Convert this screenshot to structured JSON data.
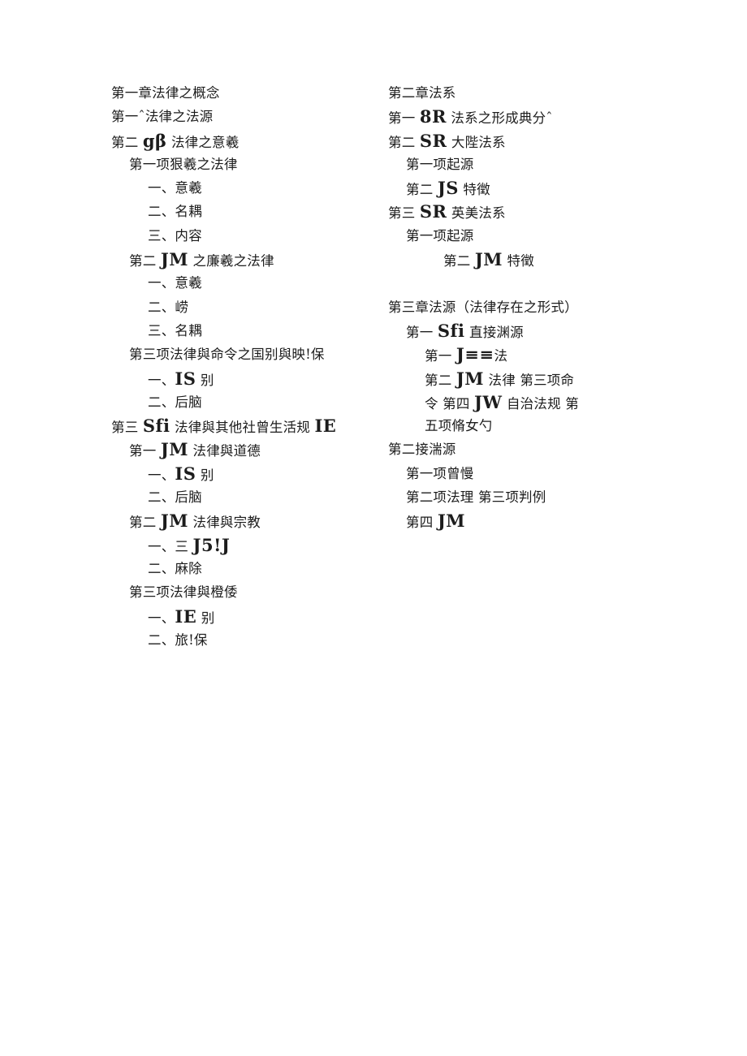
{
  "document": {
    "type": "scanned-table-of-contents",
    "page_background": "#ffffff",
    "text_color": "#1c1c1c",
    "columns": 2
  },
  "left_column": {
    "lines": [
      {
        "indent": 0,
        "text": "第一章法律之概念"
      },
      {
        "indent": 0,
        "text": "第一ˆ法律之法源"
      },
      {
        "indent": 0,
        "pre": "第二 ",
        "emph": "gβ",
        "post": " 法律之意羲"
      },
      {
        "indent": 1,
        "text": "第一项狠羲之法律"
      },
      {
        "indent": 2,
        "text": "一、意羲"
      },
      {
        "indent": 2,
        "text": "二、名耦"
      },
      {
        "indent": 2,
        "text": "三、内容"
      },
      {
        "indent": 1,
        "pre": "第二 ",
        "emph": "JM",
        "post": " 之廉羲之法律"
      },
      {
        "indent": 2,
        "text": "一、意羲"
      },
      {
        "indent": 2,
        "text": "二、崂"
      },
      {
        "indent": 2,
        "text": "三、名耦"
      },
      {
        "indent": 1,
        "text": "第三项法律與命令之国别與映!保"
      },
      {
        "indent": 2,
        "pre": "一、",
        "emph": "IS",
        "post": " 别"
      },
      {
        "indent": 2,
        "text": "二、后脑"
      },
      {
        "indent": 0,
        "pre": "第三 ",
        "emph": "Sfi",
        "post": " 法律與其他社曾生活规 ",
        "emph2": "IE"
      },
      {
        "indent": 1,
        "pre": "第一 ",
        "emph": "JM",
        "post": " 法律與道德"
      },
      {
        "indent": 2,
        "pre": "一、",
        "emph": "IS",
        "post": " 别"
      },
      {
        "indent": 2,
        "text": "二、后脑"
      },
      {
        "indent": 1,
        "pre": "第二 ",
        "emph": "JM",
        "post": " 法律與宗教"
      },
      {
        "indent": 2,
        "pre": "一、三 ",
        "emph": "J5!J",
        "post": ""
      },
      {
        "indent": 2,
        "text": "二、麻除"
      },
      {
        "indent": 1,
        "text": "第三项法律與橙倭"
      },
      {
        "indent": 2,
        "pre": "一、",
        "emph": "IE",
        "post": " 别"
      },
      {
        "indent": 2,
        "text": "二、旅!保"
      }
    ]
  },
  "right_column": {
    "lines": [
      {
        "indent": 0,
        "text": "第二章法系"
      },
      {
        "indent": 0,
        "pre": "第一 ",
        "emph": "8R",
        "post": " 法系之形成典分ˆ"
      },
      {
        "indent": 0,
        "pre": "第二 ",
        "emph": "SR",
        "post": " 大陛法系"
      },
      {
        "indent": 1,
        "text": "第一项起源"
      },
      {
        "indent": 1,
        "pre": "第二 ",
        "emph": "JS",
        "post": " 特徵"
      },
      {
        "indent": 0,
        "pre": "第三 ",
        "emph": "SR",
        "post": " 英美法系"
      },
      {
        "indent": 1,
        "text": "第一项起源"
      },
      {
        "indent": 3,
        "pre": "第二 ",
        "emph": "JM",
        "post": " 特徵"
      },
      {
        "indent": 0,
        "text": ""
      },
      {
        "indent": 0,
        "text": "第三章法源（法律存在之形式）"
      },
      {
        "indent": 1,
        "pre": "第一 ",
        "emph": "Sfi",
        "post": " 直接渊源"
      },
      {
        "indent": 2,
        "pre": "第一 ",
        "emph": "J≡≡",
        "post": "法"
      },
      {
        "indent": 2,
        "pre": "第二 ",
        "emph": "JM",
        "post": " 法律 第三项命"
      },
      {
        "indent": 2,
        "pre": "令 第四 ",
        "emph": "JW",
        "post": " 自治法规 第"
      },
      {
        "indent": 2,
        "text": "五项脩女勺"
      },
      {
        "indent": 0,
        "text": "第二接湍源"
      },
      {
        "indent": 1,
        "text": "第一项曾慢"
      },
      {
        "indent": 1,
        "text": "第二项法理 第三项判例"
      },
      {
        "indent": 1,
        "pre": "第四 ",
        "emph": "JM",
        "post": ""
      }
    ]
  }
}
